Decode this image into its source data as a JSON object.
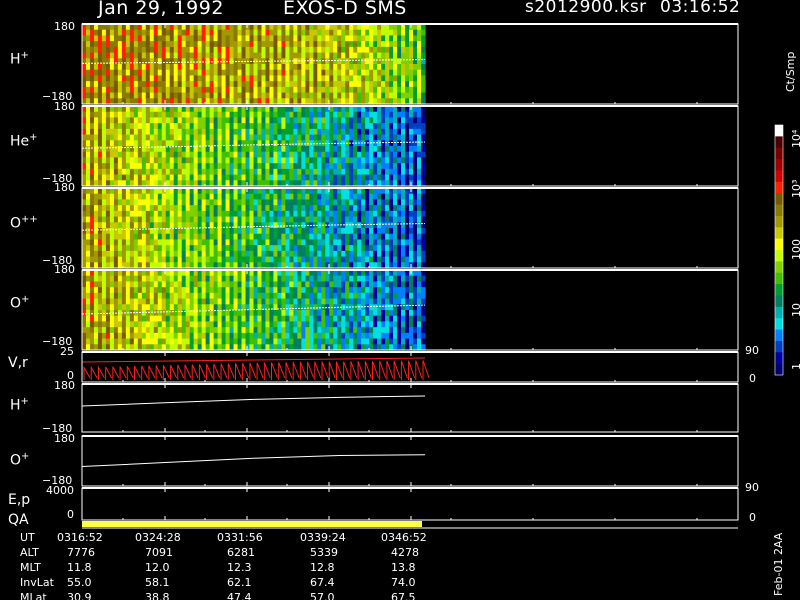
{
  "header": {
    "date": "Jan 29, 1992",
    "mission": "EXOS-D SMS",
    "file": "s2012900.ksr",
    "time": "03:16:52"
  },
  "colorbar": {
    "unit": "Ct/Smp",
    "labels": [
      "10⁴",
      "10³",
      "100",
      "10",
      "1"
    ],
    "colors": [
      "#ffffff",
      "#4a0000",
      "#7a0000",
      "#a00000",
      "#d00000",
      "#ff2000",
      "#7a5a00",
      "#8a7a00",
      "#a09a00",
      "#c8c800",
      "#ffff00",
      "#c0ff00",
      "#80d000",
      "#40c000",
      "#00a030",
      "#008060",
      "#00b0b0",
      "#00e0e0",
      "#0080ff",
      "#0040c0",
      "#0000a0",
      "#000070"
    ]
  },
  "side_note": "Feb-01 2AA",
  "chart_data": [
    {
      "type": "heatmap",
      "name": "H+",
      "label_main": "H",
      "label_sup": "+",
      "yticks": {
        "top": "180",
        "bottom": "−180"
      },
      "ylim": [
        -180,
        180
      ],
      "x": [
        "0316:52",
        "0324:28",
        "0331:56",
        "0339:24",
        "0346:52"
      ],
      "pitch_trace": [
        3,
        7,
        12,
        16,
        20
      ],
      "count_level": [
        0.9,
        0.86,
        0.82,
        0.74,
        0.55
      ]
    },
    {
      "type": "heatmap",
      "name": "He+",
      "label_main": "He",
      "label_sup": "+",
      "yticks": {
        "top": "180",
        "bottom": "−180"
      },
      "ylim": [
        -180,
        180
      ],
      "pitch_trace": [
        -10,
        -4,
        5,
        12,
        18
      ],
      "count_level": [
        0.82,
        0.64,
        0.5,
        0.32,
        0.14
      ]
    },
    {
      "type": "heatmap",
      "name": "O++",
      "label_main": "O",
      "label_sup": "++",
      "yticks": {
        "top": "180",
        "bottom": "−180"
      },
      "ylim": [
        -180,
        180
      ],
      "pitch_trace": [
        -10,
        -3,
        6,
        14,
        20
      ],
      "count_level": [
        0.84,
        0.62,
        0.46,
        0.3,
        0.15
      ]
    },
    {
      "type": "heatmap",
      "name": "O+",
      "label_main": "O",
      "label_sup": "+",
      "yticks": {
        "top": "180",
        "bottom": "−180"
      },
      "ylim": [
        -180,
        180
      ],
      "pitch_trace": [
        -18,
        -8,
        2,
        12,
        22
      ],
      "count_level": [
        0.84,
        0.66,
        0.5,
        0.32,
        0.18
      ]
    },
    {
      "type": "line",
      "name": "V,r",
      "label": "V,r",
      "yticks": {
        "top": "25",
        "bottom": "0"
      },
      "right_ticks": {
        "top": "90",
        "bottom": "0"
      },
      "ylim": [
        0,
        25
      ],
      "values": [
        12,
        14,
        16,
        17,
        18
      ]
    },
    {
      "type": "line",
      "name": "H+ pitch",
      "label_main": "H",
      "label_sup": "+",
      "yticks": {
        "top": "180",
        "bottom": "−180"
      },
      "ylim": [
        -180,
        180
      ],
      "values": [
        15,
        40,
        65,
        80,
        90
      ]
    },
    {
      "type": "line",
      "name": "O+ pitch",
      "label_main": "O",
      "label_sup": "+",
      "yticks": {
        "top": "180",
        "bottom": "−180"
      },
      "ylim": [
        -180,
        180
      ],
      "values": [
        -40,
        -10,
        20,
        40,
        45
      ]
    },
    {
      "type": "line",
      "name": "E,p",
      "label": "E,p",
      "yticks": {
        "top": "4000",
        "bottom": "0"
      },
      "right_ticks": {
        "top": "90",
        "bottom": "0"
      },
      "ylim": [
        0,
        4000
      ],
      "values": []
    }
  ],
  "qa": {
    "label": "QA",
    "bar_color": "#ffff40"
  },
  "axis_table": {
    "rows": [
      {
        "label": "UT",
        "values": [
          "0316:52",
          "0324:28",
          "0331:56",
          "0339:24",
          "0346:52"
        ]
      },
      {
        "label": "ALT",
        "values": [
          "7776",
          "7091",
          "6281",
          "5339",
          "4278"
        ]
      },
      {
        "label": "MLT",
        "values": [
          "11.8",
          "12.0",
          "12.3",
          "12.8",
          "13.8"
        ]
      },
      {
        "label": "InvLat",
        "values": [
          "55.0",
          "58.1",
          "62.1",
          "67.4",
          "74.0"
        ]
      },
      {
        "label": "MLat",
        "values": [
          "30.9",
          "38.8",
          "47.4",
          "57.0",
          "67.5"
        ]
      }
    ]
  }
}
